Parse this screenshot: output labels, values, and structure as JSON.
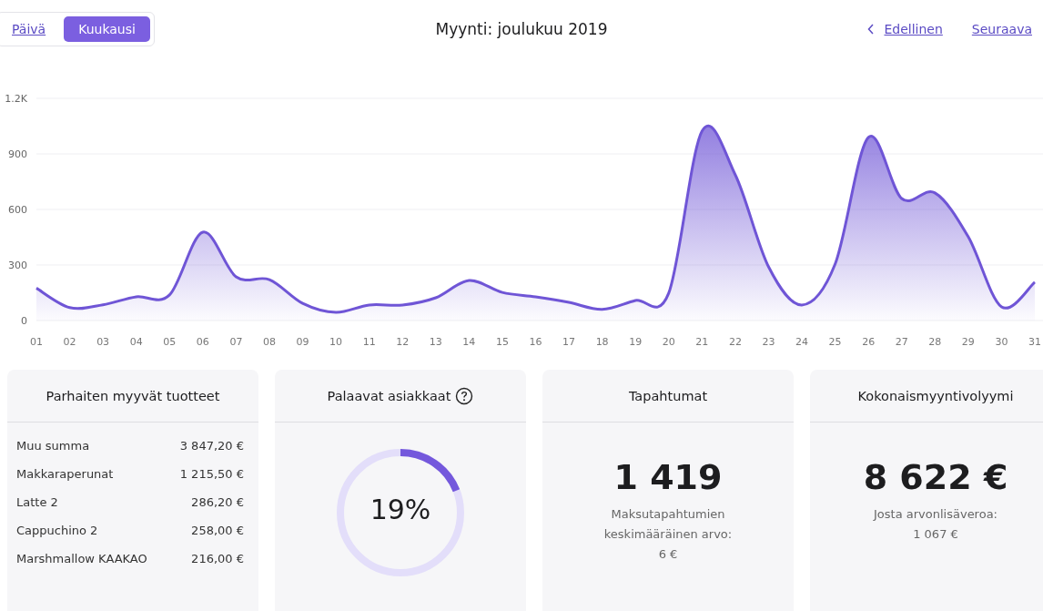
{
  "view_switch": [
    {
      "label": "Päivä",
      "selected": false
    },
    {
      "label": "Kuukausi",
      "selected": true
    }
  ],
  "title": "Myynti: joulukuu 2019",
  "nav": {
    "previous": "Edellinen",
    "next": "Seuraava"
  },
  "chart_data": {
    "type": "area",
    "x": [
      "01",
      "02",
      "03",
      "04",
      "05",
      "06",
      "07",
      "08",
      "09",
      "10",
      "11",
      "12",
      "13",
      "14",
      "15",
      "16",
      "17",
      "18",
      "19",
      "20",
      "21",
      "22",
      "23",
      "24",
      "25",
      "26",
      "27",
      "28",
      "29",
      "30",
      "31"
    ],
    "series": [
      {
        "color": "#6f55d6",
        "values": [
          175,
          70,
          85,
          128,
          138,
          477,
          236,
          221,
          93,
          44,
          84,
          84,
          123,
          216,
          152,
          128,
          98,
          60,
          108,
          148,
          1023,
          787,
          290,
          84,
          305,
          989,
          659,
          689,
          452,
          74,
          207
        ]
      }
    ],
    "ylim": [
      0,
      1200
    ],
    "grid": true,
    "yticks": [
      0,
      300,
      600,
      900,
      {
        "value": 1200,
        "label": "1.2K"
      }
    ]
  },
  "cards": [
    {
      "kind": "list",
      "title": "Parhaiten myyvät tuotteet",
      "rows": [
        {
          "name": "Muu summa",
          "amount": "3 847,20 €"
        },
        {
          "name": "Makkaraperunat",
          "amount": "1 215,50 €"
        },
        {
          "name": "Latte 2",
          "amount": "286,20 €"
        },
        {
          "name": "Cappuchino 2",
          "amount": "258,00 €"
        },
        {
          "name": "Marshmallow KAAKAO",
          "amount": "216,00 €"
        }
      ]
    },
    {
      "kind": "ring",
      "title": "Palaavat asiakkaat",
      "help": true,
      "value": "19%"
    },
    {
      "kind": "stat",
      "title": "Tapahtumat",
      "value": "1 419",
      "note": [
        "Maksutapahtumien",
        "keskimääräinen arvo:",
        "6 €"
      ]
    },
    {
      "kind": "stat",
      "title": "Kokonaismyyntivolyymi",
      "value": "8 622 €",
      "note": [
        "Josta arvonlisäveroa:",
        "1 067 €"
      ]
    }
  ]
}
